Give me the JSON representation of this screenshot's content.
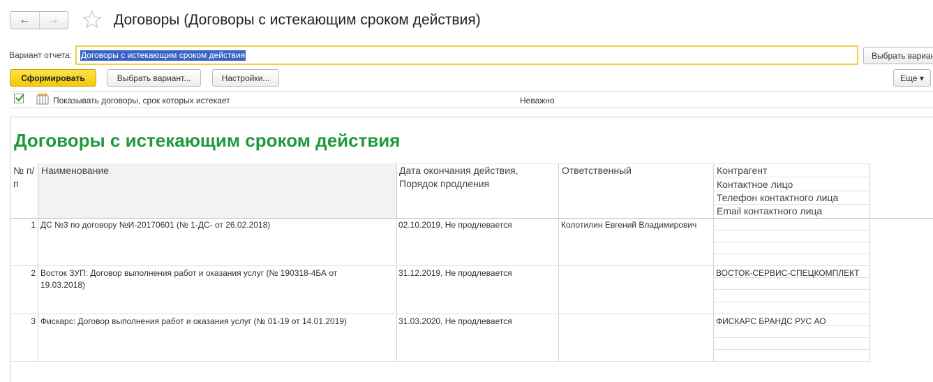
{
  "toolbar": {
    "back_icon": "←",
    "forward_icon": "→"
  },
  "window": {
    "title": "Договоры (Договоры с истекающим сроком действия)"
  },
  "variant": {
    "label": "Вариант отчета:",
    "value": "Договоры с истекающим сроком действия",
    "choose_button": "Выбрать вариант..."
  },
  "commands": {
    "form": "Сформировать",
    "choose_variant": "Выбрать вариант...",
    "settings": "Настройки...",
    "more": "Еще ▾"
  },
  "filter": {
    "checked": true,
    "label": "Показывать договоры, срок которых истекает",
    "value": "Неважно"
  },
  "report": {
    "title": "Договоры с истекающим сроком действия",
    "headers": {
      "num": "№ п/п",
      "name": "Наименование",
      "date": "Дата окончания действия, Порядок продления",
      "responsible": "Ответственный",
      "contractor": [
        "Контрагент",
        "Контактное лицо",
        "Телефон контактного лица",
        "Email контактного лица"
      ]
    },
    "rows": [
      {
        "num": "1",
        "name": "ДС №3 по договору №И-20170601 (№ 1-ДС- от 26.02.2018)",
        "date": "02.10.2019, Не продлевается",
        "responsible": "Колотилин Евгений Владимирович",
        "contractor": ""
      },
      {
        "num": "2",
        "name": "Восток ЗУП: Договор выполнения работ и оказания услуг (№ 190318-4БА от 19.03.2018)",
        "date": "31.12.2019, Не продлевается",
        "responsible": "",
        "contractor": "ВОСТОК-СЕРВИС-СПЕЦКОМПЛЕКТ"
      },
      {
        "num": "3",
        "name": "Фискарс: Договор выполнения работ и оказания услуг (№ 01-19 от 14.01.2019)",
        "date": "31.03.2020, Не продлевается",
        "responsible": "",
        "contractor": "ФИСКАРС БРАНДС РУС АО"
      }
    ]
  },
  "colors": {
    "accent_yellow": "#f5d21e",
    "title_green": "#1f9a3a",
    "selection_blue": "#3a64c4"
  }
}
